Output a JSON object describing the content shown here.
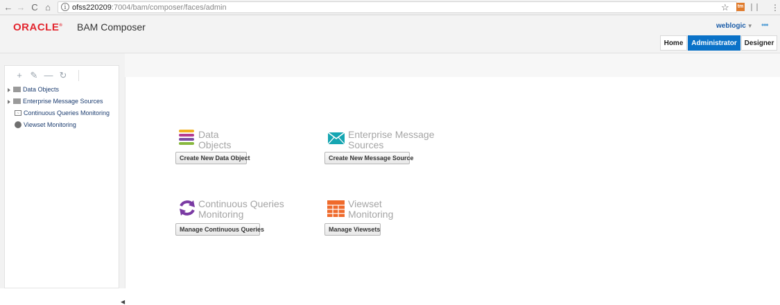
{
  "browser": {
    "url_host": "ofss220209",
    "url_rest": ":7004/bam/composer/faces/admin",
    "back": "←",
    "forward": "→",
    "reload": "C",
    "home": "⌂",
    "star": "☆",
    "ext_label": "tm",
    "menu": "⋮"
  },
  "header": {
    "logo": "ORACLE",
    "title": "BAM Composer",
    "user": "weblogic",
    "more": "•••",
    "tabs": [
      {
        "label": "Home",
        "active": false
      },
      {
        "label": "Administrator",
        "active": true
      },
      {
        "label": "Designer",
        "active": false
      }
    ]
  },
  "sidebar": {
    "toolbar": [
      "+",
      "✎",
      "—",
      "↻"
    ],
    "items": [
      {
        "label": "Data Objects",
        "icon": "folder-icon",
        "expandable": true
      },
      {
        "label": "Enterprise Message Sources",
        "icon": "folder-icon",
        "expandable": true
      },
      {
        "label": "Continuous Queries Monitoring",
        "icon": "monitor-icon",
        "expandable": false
      },
      {
        "label": "Viewset Monitoring",
        "icon": "viewset-icon",
        "expandable": false
      }
    ]
  },
  "tiles": {
    "data_objects": {
      "title_1": "Data",
      "title_2": "Objects",
      "button": "Create New Data Object"
    },
    "message_sources": {
      "title_1": "Enterprise Message",
      "title_2": "Sources",
      "button": "Create New Message Source"
    },
    "continuous_queries": {
      "title_1": "Continuous Queries",
      "title_2": "Monitoring",
      "button": "Manage Continuous Queries"
    },
    "viewsets": {
      "title_1": "Viewset",
      "title_2": "Monitoring",
      "button": "Manage Viewsets"
    }
  },
  "colors": {
    "oracle_red": "#e3262f",
    "active_tab": "#0a72c8",
    "tile_title": "#a5a5a5"
  }
}
